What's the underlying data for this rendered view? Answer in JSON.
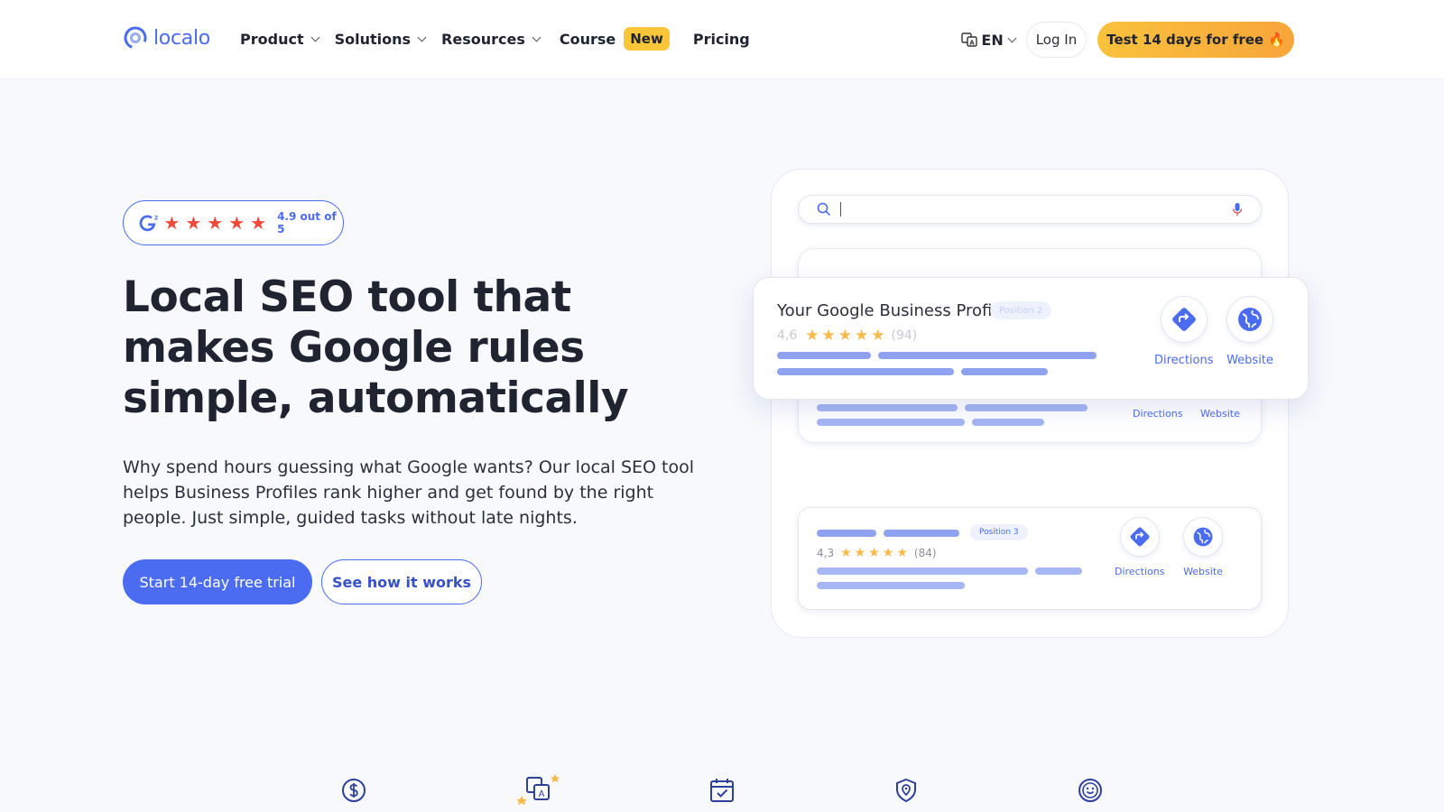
{
  "brand": {
    "name": "localo",
    "color": "#4b6cf0"
  },
  "nav": {
    "items": [
      {
        "label": "Product",
        "has_dropdown": true
      },
      {
        "label": "Solutions",
        "has_dropdown": true
      },
      {
        "label": "Resources",
        "has_dropdown": true
      },
      {
        "label": "Course",
        "badge": "New"
      },
      {
        "label": "Pricing"
      }
    ],
    "language": "EN",
    "login_label": "Log In",
    "cta_label": "Test 14 days for free 🔥"
  },
  "hero": {
    "rating_text": "4.9 out of 5",
    "rating_stars": 5,
    "headline": "Local SEO tool that makes Google rules simple, automatically",
    "subtext": "Why spend hours guessing what Google wants? Our local SEO tool helps Business Profiles rank higher and get found by the right people. Just simple, guided tasks without late nights.",
    "primary_cta": "Start 14-day free trial",
    "secondary_cta": "See how it works"
  },
  "mockup": {
    "main_card": {
      "title": "Your Google Business Profile",
      "position_badge": "Position 2",
      "rating": "4,6",
      "stars": 5,
      "review_count": "(94)",
      "directions_label": "Directions",
      "website_label": "Website"
    },
    "under_card": {
      "directions_label": "Directions",
      "website_label": "Website"
    },
    "third_card": {
      "position_badge": "Position 3",
      "rating": "4,3",
      "stars": 5,
      "review_count": "(84)",
      "directions_label": "Directions",
      "website_label": "Website"
    }
  },
  "features": {
    "icons": [
      "dollar-icon",
      "translate-icon",
      "calendar-check-icon",
      "shield-location-icon",
      "smiley-icon"
    ]
  },
  "colors": {
    "accent": "#4b6cf0",
    "cta_yellow": "#f9c23c",
    "star_red": "#f04a3a",
    "star_gold": "#f6b94a",
    "hero_bg": "#f7f9fc"
  }
}
